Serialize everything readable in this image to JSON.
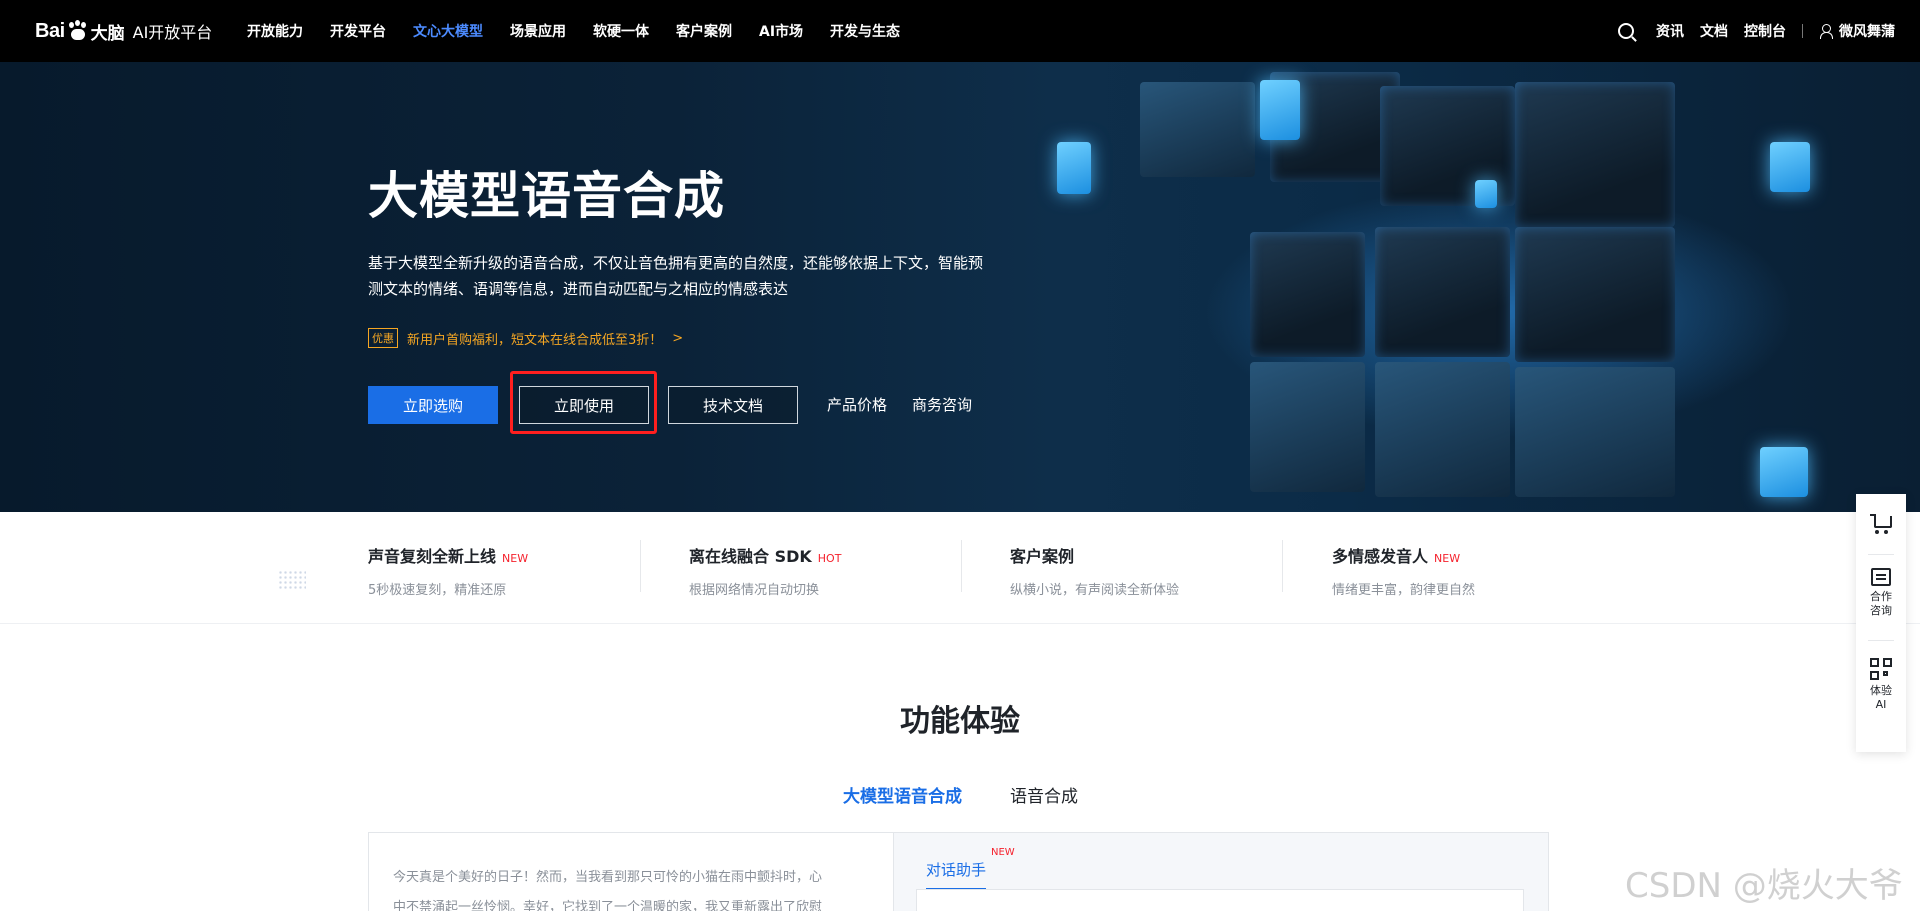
{
  "nav": {
    "logo_text": "Bai",
    "logo_brand": "大脑",
    "logo_platform": "AI开放平台",
    "items": [
      {
        "label": "开放能力",
        "active": false
      },
      {
        "label": "开发平台",
        "active": false
      },
      {
        "label": "文心大模型",
        "active": true
      },
      {
        "label": "场景应用",
        "active": false
      },
      {
        "label": "软硬一体",
        "active": false
      },
      {
        "label": "客户案例",
        "active": false
      },
      {
        "label": "AI市场",
        "active": false
      },
      {
        "label": "开发与生态",
        "active": false
      }
    ],
    "right": {
      "search_icon": "search-icon",
      "news": "资讯",
      "docs": "文档",
      "console": "控制台",
      "user_icon": "user-icon",
      "username": "微风舞蒲"
    },
    "accent_color": "#4c8bff"
  },
  "hero": {
    "title": "大模型语音合成",
    "description": "基于大模型全新升级的语音合成，不仅让音色拥有更高的自然度，还能够依据上下文，智能预测文本的情绪、语调等信息，进而自动匹配与之相应的情感表达",
    "promo_tag": "优惠",
    "promo_text": "新用户首购福利，短文本在线合成低至3折！",
    "promo_arrow": ">",
    "buttons": {
      "buy": "立即选购",
      "use": "立即使用",
      "docs": "技术文档"
    },
    "links": {
      "price": "产品价格",
      "consult": "商务咨询"
    },
    "primary_color": "#1a6ee6",
    "highlight_color": "#ff1f1f"
  },
  "features": [
    {
      "title": "声音复刻全新上线",
      "badge": "NEW",
      "subtitle": "5秒极速复刻，精准还原"
    },
    {
      "title": "离在线融合 SDK",
      "badge": "HOT",
      "subtitle": "根据网络情况自动切换"
    },
    {
      "title": "客户案例",
      "badge": "",
      "subtitle": "纵横小说，有声阅读全新体验"
    },
    {
      "title": "多情感发音人",
      "badge": "NEW",
      "subtitle": "情绪更丰富，韵律更自然"
    }
  ],
  "experience": {
    "section_title": "功能体验",
    "tabs": [
      "大模型语音合成",
      "语音合成"
    ],
    "sample_text_line1": "今天真是个美好的日子！然而，当我看到那只可怜的小猫在雨中颤抖时，心",
    "sample_text_line2": "中不禁涌起一丝怜悯。幸好，它找到了一个温暖的家，我又重新露出了欣慰",
    "chat_tab": "对话助手",
    "chat_badge": "NEW"
  },
  "sidebar": {
    "cart_icon": "cart-icon",
    "consult_line1": "合作",
    "consult_line2": "咨询",
    "try_line1": "体验",
    "try_line2": "AI"
  },
  "watermark": "CSDN @烧火大爷"
}
